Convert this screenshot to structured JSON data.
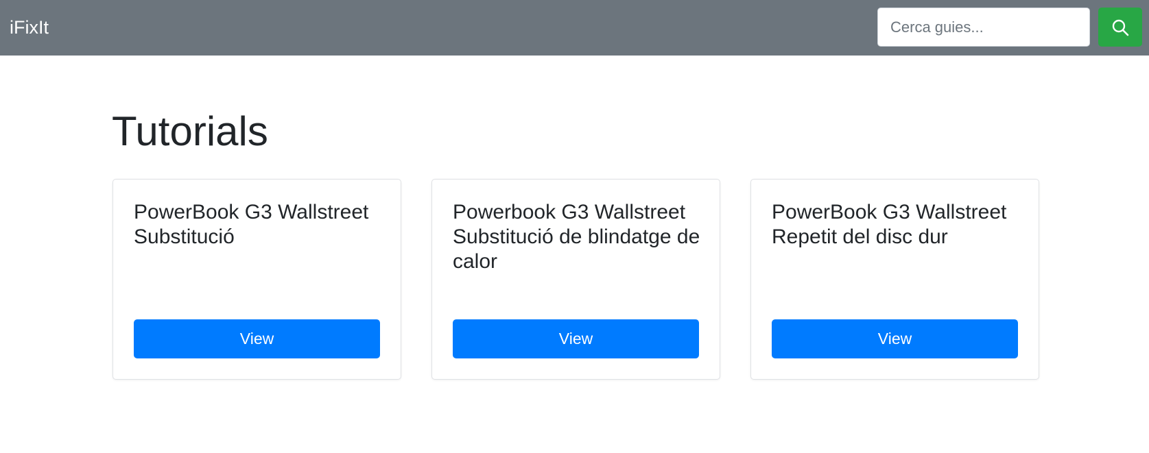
{
  "navbar": {
    "brand": "iFixIt",
    "search": {
      "placeholder": "Cerca guies...",
      "value": "",
      "button_icon": "search-icon"
    }
  },
  "main": {
    "title": "Tutorials",
    "cards": [
      {
        "title": "PowerBook G3 Wallstreet Substitució",
        "button_label": "View"
      },
      {
        "title": "Powerbook G3 Wallstreet Substitució de blindatge de calor",
        "button_label": "View"
      },
      {
        "title": "PowerBook G3 Wallstreet Repetit del disc dur",
        "button_label": "View"
      }
    ]
  },
  "colors": {
    "navbar_bg": "#6c757d",
    "search_button": "#28a745",
    "primary_button": "#007bff",
    "text": "#212529"
  }
}
